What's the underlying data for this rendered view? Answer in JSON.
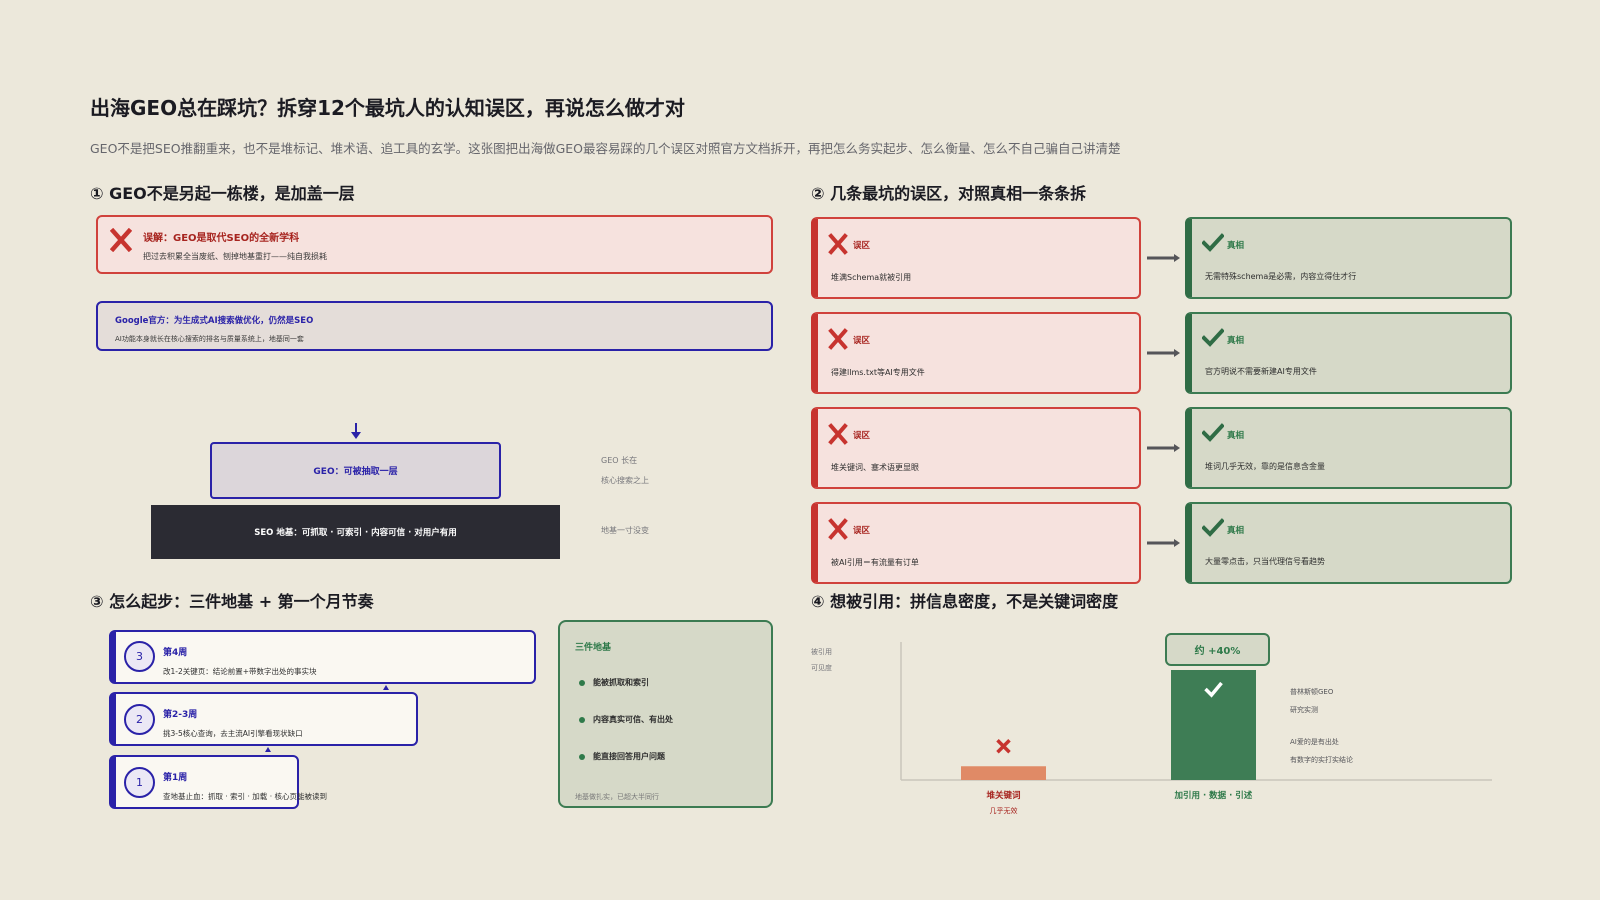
{
  "title": "出海GEO总在踩坑？拆穿12个最坑人的认知误区，再说怎么做才对",
  "subtitle": "GEO不是把SEO推翻重来，也不是堆标记、堆术语、追工具的玄学。这张图把出海做GEO最容易踩的几个误区对照官方文档拆开，再把怎么务实起步、怎么衡量、怎么不自己骗自己讲清楚",
  "section1": {
    "title": "① GEO不是另起一栋楼，是加盖一层",
    "myth_title": "误解：GEO是取代SEO的全新学科",
    "myth_desc": "把过去积累全当废纸、刨掉地基重打——纯自我损耗",
    "google_title": "Google官方：为生成式AI搜索做优化，仍然是SEO",
    "google_desc": "AI功能本身就长在核心搜索的排名与质量系统上，地基同一套",
    "geo_layer": "GEO：可被抽取一层",
    "seo_layer": "SEO 地基：可抓取 · 可索引 · 内容可信 · 对用户有用",
    "note_geo_1": "GEO 长在",
    "note_geo_2": "核心搜索之上",
    "note_seo": "地基一寸没变"
  },
  "section2": {
    "title": "② 几条最坑的误区，对照真相一条条拆",
    "myth_label": "误区",
    "truth_label": "真相",
    "pairs": [
      {
        "myth": "堆满Schema就被引用",
        "truth": "无需特殊schema是必需，内容立得住才行"
      },
      {
        "myth": "得建llms.txt等AI专用文件",
        "truth": "官方明说不需要新建AI专用文件"
      },
      {
        "myth": "堆关键词、塞术语更显眼",
        "truth": "堆词几乎无效，靠的是信息含金量"
      },
      {
        "myth": "被AI引用＝有流量有订单",
        "truth": "大量零点击，只当代理信号看趋势"
      }
    ]
  },
  "section3": {
    "title": "③ 怎么起步：三件地基 + 第一个月节奏",
    "weeks": [
      {
        "num": "3",
        "title": "第4周",
        "desc": "改1-2关键页：结论前置+带数字出处的事实块"
      },
      {
        "num": "2",
        "title": "第2-3周",
        "desc": "挑3-5核心查询，去主流AI引擎看现状缺口"
      },
      {
        "num": "1",
        "title": "第1周",
        "desc": "查地基止血：抓取 · 索引 · 加载 · 核心页能被读到"
      }
    ],
    "foundation_title": "三件地基",
    "foundation_items": [
      "能被抓取和索引",
      "内容真实可信、有出处",
      "能直接回答用户问题"
    ],
    "foundation_note": "地基做扎实，已超大半同行"
  },
  "section4": {
    "title": "④ 想被引用：拼信息密度，不是关键词密度",
    "y_label_1": "被引用",
    "y_label_2": "可见度",
    "badge": "约 +40%",
    "side_note_1": "普林斯顿GEO",
    "side_note_2": "研究实测",
    "side_note_3": "AI爱的是有出处",
    "side_note_4": "有数字的实打实结论",
    "chart_data": {
      "type": "bar",
      "categories": [
        "堆关键词",
        "加引用 · 数据 · 引述"
      ],
      "category_notes": [
        "几乎无效",
        ""
      ],
      "values": [
        1,
        8
      ],
      "annotations": [
        "约 +40%"
      ],
      "ylabel": "被引用 可见度",
      "colors": [
        "#e08a66",
        "#3e7d55"
      ]
    }
  },
  "colors": {
    "background": "#ece8db",
    "myth_red": "#d0423c",
    "truth_green": "#3c7b52",
    "accent_blue": "#2a22a8",
    "dark": "#2b2b33"
  }
}
